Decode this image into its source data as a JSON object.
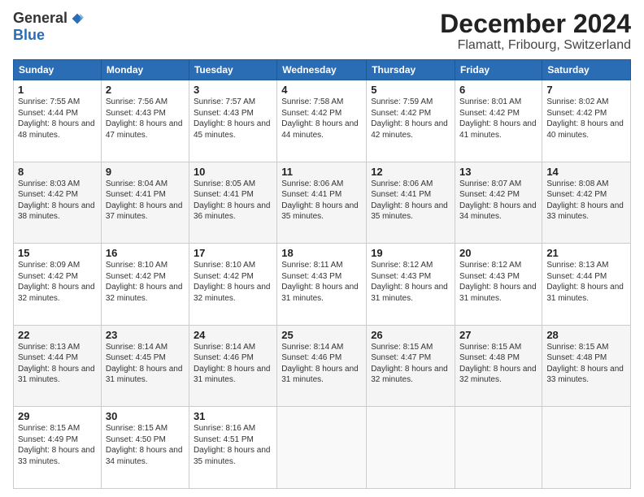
{
  "logo": {
    "general": "General",
    "blue": "Blue"
  },
  "header": {
    "title": "December 2024",
    "subtitle": "Flamatt, Fribourg, Switzerland"
  },
  "weekdays": [
    "Sunday",
    "Monday",
    "Tuesday",
    "Wednesday",
    "Thursday",
    "Friday",
    "Saturday"
  ],
  "weeks": [
    [
      {
        "day": "1",
        "detail": "Sunrise: 7:55 AM\nSunset: 4:44 PM\nDaylight: 8 hours\nand 48 minutes."
      },
      {
        "day": "2",
        "detail": "Sunrise: 7:56 AM\nSunset: 4:43 PM\nDaylight: 8 hours\nand 47 minutes."
      },
      {
        "day": "3",
        "detail": "Sunrise: 7:57 AM\nSunset: 4:43 PM\nDaylight: 8 hours\nand 45 minutes."
      },
      {
        "day": "4",
        "detail": "Sunrise: 7:58 AM\nSunset: 4:42 PM\nDaylight: 8 hours\nand 44 minutes."
      },
      {
        "day": "5",
        "detail": "Sunrise: 7:59 AM\nSunset: 4:42 PM\nDaylight: 8 hours\nand 42 minutes."
      },
      {
        "day": "6",
        "detail": "Sunrise: 8:01 AM\nSunset: 4:42 PM\nDaylight: 8 hours\nand 41 minutes."
      },
      {
        "day": "7",
        "detail": "Sunrise: 8:02 AM\nSunset: 4:42 PM\nDaylight: 8 hours\nand 40 minutes."
      }
    ],
    [
      {
        "day": "8",
        "detail": "Sunrise: 8:03 AM\nSunset: 4:42 PM\nDaylight: 8 hours\nand 38 minutes."
      },
      {
        "day": "9",
        "detail": "Sunrise: 8:04 AM\nSunset: 4:41 PM\nDaylight: 8 hours\nand 37 minutes."
      },
      {
        "day": "10",
        "detail": "Sunrise: 8:05 AM\nSunset: 4:41 PM\nDaylight: 8 hours\nand 36 minutes."
      },
      {
        "day": "11",
        "detail": "Sunrise: 8:06 AM\nSunset: 4:41 PM\nDaylight: 8 hours\nand 35 minutes."
      },
      {
        "day": "12",
        "detail": "Sunrise: 8:06 AM\nSunset: 4:41 PM\nDaylight: 8 hours\nand 35 minutes."
      },
      {
        "day": "13",
        "detail": "Sunrise: 8:07 AM\nSunset: 4:42 PM\nDaylight: 8 hours\nand 34 minutes."
      },
      {
        "day": "14",
        "detail": "Sunrise: 8:08 AM\nSunset: 4:42 PM\nDaylight: 8 hours\nand 33 minutes."
      }
    ],
    [
      {
        "day": "15",
        "detail": "Sunrise: 8:09 AM\nSunset: 4:42 PM\nDaylight: 8 hours\nand 32 minutes."
      },
      {
        "day": "16",
        "detail": "Sunrise: 8:10 AM\nSunset: 4:42 PM\nDaylight: 8 hours\nand 32 minutes."
      },
      {
        "day": "17",
        "detail": "Sunrise: 8:10 AM\nSunset: 4:42 PM\nDaylight: 8 hours\nand 32 minutes."
      },
      {
        "day": "18",
        "detail": "Sunrise: 8:11 AM\nSunset: 4:43 PM\nDaylight: 8 hours\nand 31 minutes."
      },
      {
        "day": "19",
        "detail": "Sunrise: 8:12 AM\nSunset: 4:43 PM\nDaylight: 8 hours\nand 31 minutes."
      },
      {
        "day": "20",
        "detail": "Sunrise: 8:12 AM\nSunset: 4:43 PM\nDaylight: 8 hours\nand 31 minutes."
      },
      {
        "day": "21",
        "detail": "Sunrise: 8:13 AM\nSunset: 4:44 PM\nDaylight: 8 hours\nand 31 minutes."
      }
    ],
    [
      {
        "day": "22",
        "detail": "Sunrise: 8:13 AM\nSunset: 4:44 PM\nDaylight: 8 hours\nand 31 minutes."
      },
      {
        "day": "23",
        "detail": "Sunrise: 8:14 AM\nSunset: 4:45 PM\nDaylight: 8 hours\nand 31 minutes."
      },
      {
        "day": "24",
        "detail": "Sunrise: 8:14 AM\nSunset: 4:46 PM\nDaylight: 8 hours\nand 31 minutes."
      },
      {
        "day": "25",
        "detail": "Sunrise: 8:14 AM\nSunset: 4:46 PM\nDaylight: 8 hours\nand 31 minutes."
      },
      {
        "day": "26",
        "detail": "Sunrise: 8:15 AM\nSunset: 4:47 PM\nDaylight: 8 hours\nand 32 minutes."
      },
      {
        "day": "27",
        "detail": "Sunrise: 8:15 AM\nSunset: 4:48 PM\nDaylight: 8 hours\nand 32 minutes."
      },
      {
        "day": "28",
        "detail": "Sunrise: 8:15 AM\nSunset: 4:48 PM\nDaylight: 8 hours\nand 33 minutes."
      }
    ],
    [
      {
        "day": "29",
        "detail": "Sunrise: 8:15 AM\nSunset: 4:49 PM\nDaylight: 8 hours\nand 33 minutes."
      },
      {
        "day": "30",
        "detail": "Sunrise: 8:15 AM\nSunset: 4:50 PM\nDaylight: 8 hours\nand 34 minutes."
      },
      {
        "day": "31",
        "detail": "Sunrise: 8:16 AM\nSunset: 4:51 PM\nDaylight: 8 hours\nand 35 minutes."
      },
      {
        "day": "",
        "detail": ""
      },
      {
        "day": "",
        "detail": ""
      },
      {
        "day": "",
        "detail": ""
      },
      {
        "day": "",
        "detail": ""
      }
    ]
  ]
}
